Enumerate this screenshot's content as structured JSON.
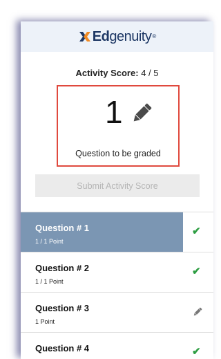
{
  "header": {
    "logo_ed": "Ed",
    "logo_rest": "genuity",
    "logo_tm": "®",
    "accent_blue": "#1d3764",
    "accent_orange": "#f08a24"
  },
  "score": {
    "label": "Activity Score:",
    "value": "4 / 5"
  },
  "grading": {
    "count": "1",
    "caption": "Question to be graded",
    "icon": "pencil-icon",
    "highlight_color": "#e0493e"
  },
  "submit": {
    "label": "Submit Activity Score",
    "disabled": true
  },
  "questions": [
    {
      "title": "Question # 1",
      "points": "1 / 1 Point",
      "status": "check-icon",
      "active": true
    },
    {
      "title": "Question # 2",
      "points": "1 / 1 Point",
      "status": "check-icon",
      "active": false
    },
    {
      "title": "Question # 3",
      "points": "1 Point",
      "status": "pencil-icon",
      "active": false
    },
    {
      "title": "Question # 4",
      "points": "",
      "status": "check-icon",
      "active": false
    }
  ],
  "colors": {
    "active_row": "#7b96b3",
    "check": "#2e9e43"
  }
}
